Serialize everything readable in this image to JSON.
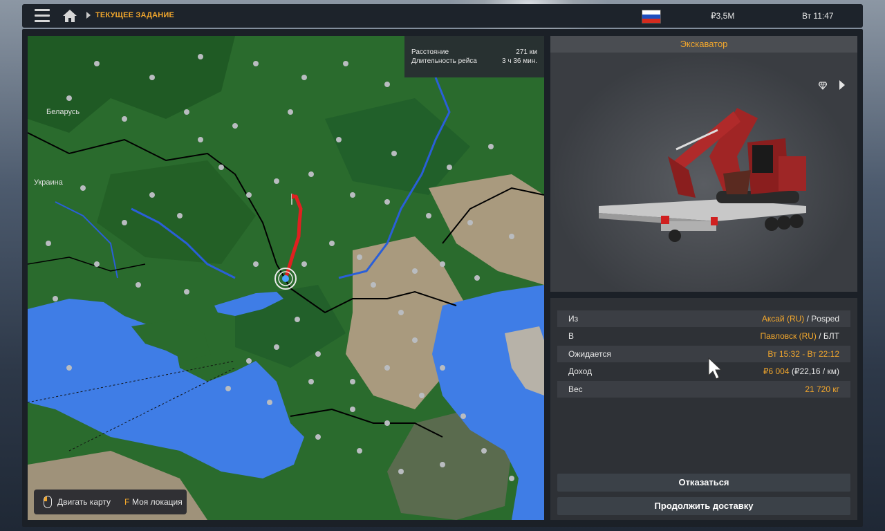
{
  "topbar": {
    "breadcrumb": "ТЕКУЩЕЕ ЗАДАНИЕ",
    "money": "₽3,5M",
    "clock": "Вт 11:47",
    "flag_colors": [
      "#ffffff",
      "#1f4fbf",
      "#d52b1e"
    ]
  },
  "map": {
    "info": {
      "distance_label": "Расстояние",
      "distance_value": "271 км",
      "duration_label": "Длительность рейса",
      "duration_value": "3 ч 36 мин."
    },
    "labels": {
      "belarus": "Беларусь",
      "ukraine": "Украина"
    },
    "hints": {
      "move_map": "Двигать карту",
      "key": "F",
      "my_location": "Моя локация"
    }
  },
  "cargo": {
    "title": "Экскаватор"
  },
  "details": {
    "rows": [
      {
        "label": "Из",
        "value_highlight": "Аксай (RU)",
        "value_rest": " / Posped"
      },
      {
        "label": "В",
        "value_highlight": "Павловск (RU)",
        "value_rest": " / БЛТ"
      },
      {
        "label": "Ожидается",
        "value_highlight": "Вт 15:32 - Вт 22:12",
        "value_rest": ""
      },
      {
        "label": "Доход",
        "value_highlight": "₽6 004",
        "value_rest": " (₽22,16 / км)"
      },
      {
        "label": "Вес",
        "value_highlight": "21 720 кг",
        "value_rest": ""
      }
    ],
    "decline_label": "Отказаться",
    "continue_label": "Продолжить доставку"
  },
  "colors": {
    "accent": "#f2a72d",
    "land_green": "#2a6b2d",
    "water": "#3f7de6",
    "route": "#e02020"
  }
}
